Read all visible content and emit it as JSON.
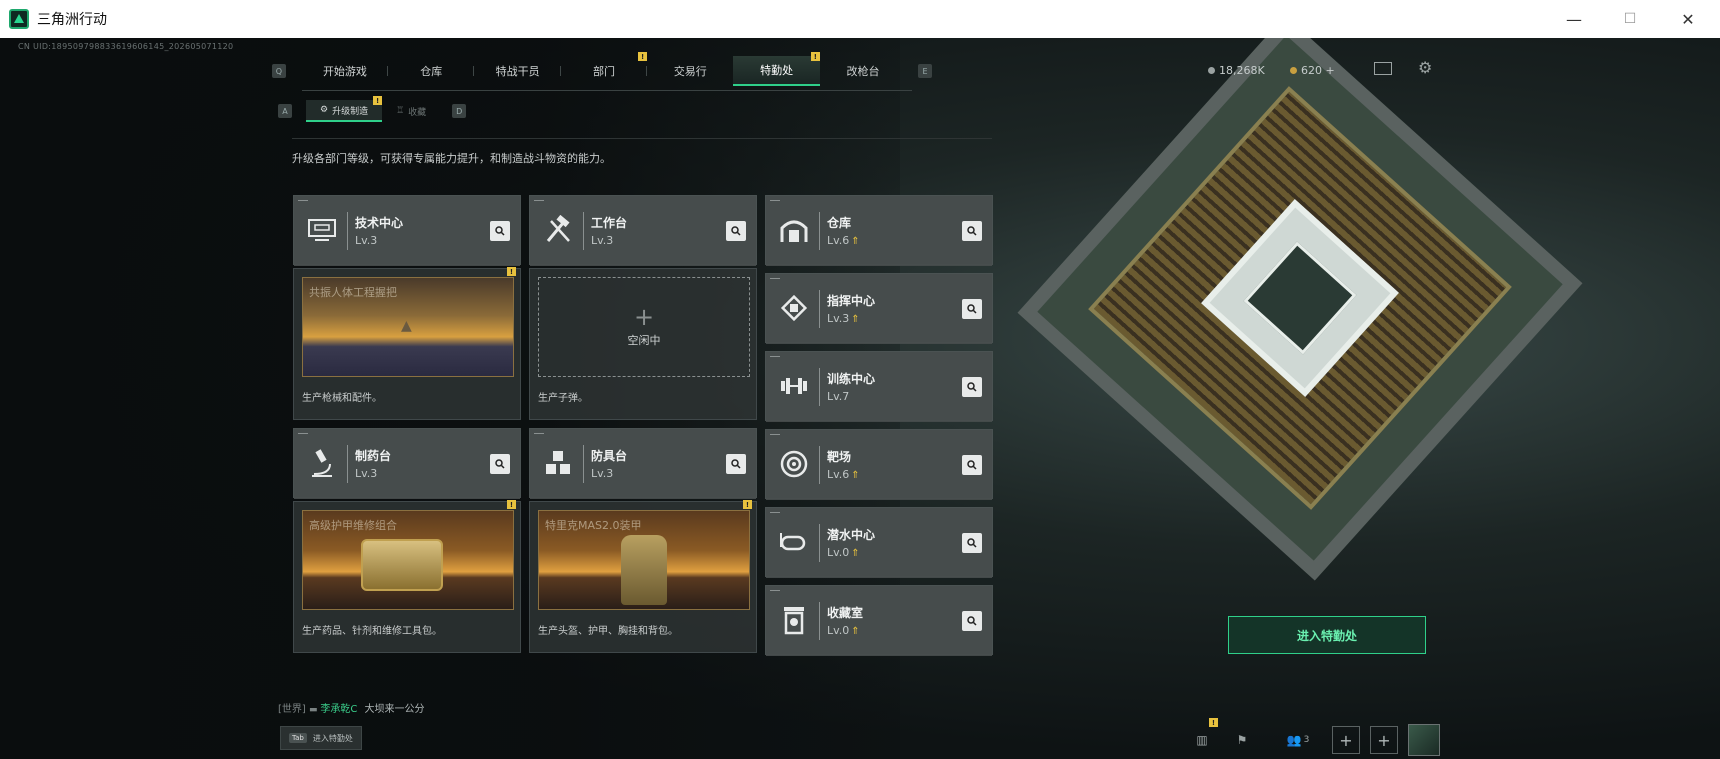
{
  "window": {
    "title": "三角洲行动",
    "minimize": "—",
    "maximize": "☐",
    "close": "✕"
  },
  "uid": "CN UID:1895097988336196061​45_202605071120",
  "nav": {
    "left_key": "Q",
    "right_key": "E",
    "tabs": [
      {
        "label": "开始游戏"
      },
      {
        "label": "仓库"
      },
      {
        "label": "特战干员"
      },
      {
        "label": "部门",
        "badge": "!"
      },
      {
        "label": "交易行"
      },
      {
        "label": "特勤处",
        "badge": "!",
        "active": true
      },
      {
        "label": "改枪台"
      }
    ]
  },
  "subnav": {
    "left_key": "A",
    "right_key": "D",
    "tabs": [
      {
        "label": "升级制造",
        "badge": "!",
        "active": true
      },
      {
        "label": "收藏"
      }
    ]
  },
  "hud": {
    "currency1": "18,268K",
    "currency2": "620 +"
  },
  "description": "升级各部门等级，可获得专属能力提升，和制造战斗物资的能力。",
  "facilities": {
    "tech": {
      "name": "技术中心",
      "lv": "Lv.3",
      "product_title": "共振人体工程握把",
      "product_desc": "生产枪械和配件。",
      "badge": "!"
    },
    "workbench": {
      "name": "工作台",
      "lv": "Lv.3",
      "idle_text": "空闲中",
      "idle_plus": "+",
      "product_desc": "生产子弹。"
    },
    "pharmacy": {
      "name": "制药台",
      "lv": "Lv.3",
      "product_title": "高级护甲维修组合",
      "product_desc": "生产药品、针剂和维修工具包。",
      "badge": "!"
    },
    "armor": {
      "name": "防具台",
      "lv": "Lv.3",
      "product_title": "特里克MAS2.0装甲",
      "product_desc": "生产头盔、护甲、胸挂和背包。",
      "badge": "!"
    },
    "right": [
      {
        "name": "仓库",
        "lv": "Lv.6",
        "upgrade": true,
        "icon": "warehouse-icon"
      },
      {
        "name": "指挥中心",
        "lv": "Lv.3",
        "upgrade": true,
        "icon": "command-icon"
      },
      {
        "name": "训练中心",
        "lv": "Lv.7",
        "upgrade": false,
        "icon": "dumbbell-icon"
      },
      {
        "name": "靶场",
        "lv": "Lv.6",
        "upgrade": true,
        "icon": "target-icon"
      },
      {
        "name": "潜水中心",
        "lv": "Lv.0",
        "upgrade": true,
        "icon": "diving-mask-icon"
      },
      {
        "name": "收藏室",
        "lv": "Lv.0",
        "upgrade": true,
        "icon": "collection-icon"
      }
    ]
  },
  "enter_button": "进入特勤处",
  "chat": {
    "channel": "[世界]",
    "user": "李承乾C",
    "message": "大坝来一公分"
  },
  "tab_hint": {
    "key": "Tab",
    "label": "进入特勤处"
  },
  "bottom": {
    "friends_count": "3",
    "bottom_badge": "!"
  },
  "colors": {
    "accent": "#2fd08a",
    "badge": "#e8c23e",
    "upgrade": "#e8c23e"
  }
}
